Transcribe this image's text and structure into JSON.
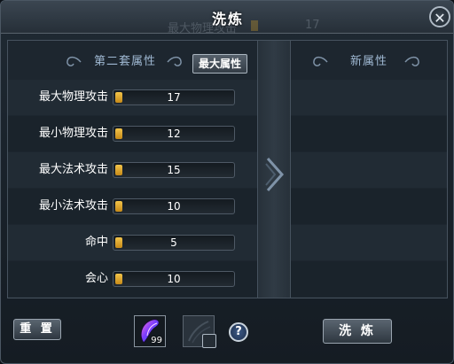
{
  "window": {
    "title": "洗炼",
    "close_label": "✕"
  },
  "background_ghost": {
    "label": "最大物理攻击",
    "value": "17"
  },
  "left_panel": {
    "header": "第二套属性",
    "max_button": "最大属性",
    "attributes": [
      {
        "label": "最大物理攻击",
        "value": "17"
      },
      {
        "label": "最小物理攻击",
        "value": "12"
      },
      {
        "label": "最大法术攻击",
        "value": "15"
      },
      {
        "label": "最小法术攻击",
        "value": "10"
      },
      {
        "label": "命中",
        "value": "5"
      },
      {
        "label": "会心",
        "value": "10"
      }
    ]
  },
  "right_panel": {
    "header": "新属性"
  },
  "bottom": {
    "reset_button": "重 置",
    "wash_button": "洗 炼",
    "item_slot": {
      "icon": "purple-crystal-icon",
      "count": "99"
    },
    "empty_slot": {
      "icon": "empty-slot-icon"
    },
    "help_label": "?"
  },
  "colors": {
    "accent_bar": "#e0a42c",
    "header_text": "#9fb8d2",
    "text": "#ffffff"
  }
}
